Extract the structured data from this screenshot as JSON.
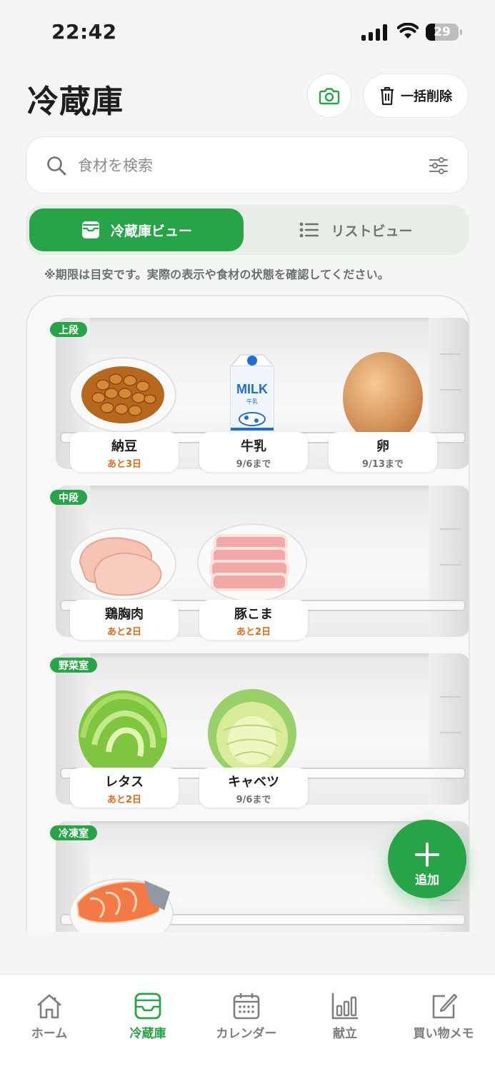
{
  "status_bar": {
    "time": "22:42",
    "battery": "29"
  },
  "header": {
    "title": "冷蔵庫",
    "camera_icon": "camera-icon",
    "bulk_delete_label": "一括削除"
  },
  "search": {
    "placeholder": "食材を検索"
  },
  "view_toggle": {
    "fridge_view_label": "冷蔵庫ビュー",
    "list_view_label": "リストビュー",
    "active": "fridge"
  },
  "note": "※期限は目安です。実際の表示や食材の状態を確認してください。",
  "colors": {
    "accent": "#27a348",
    "warning": "#e06a1c",
    "muted": "#6d726e"
  },
  "shelves": [
    {
      "label": "上段",
      "items": [
        {
          "name": "納豆",
          "expiry": "あと3日",
          "status": "warning",
          "icon": "natto-icon"
        },
        {
          "name": "牛乳",
          "expiry": "9/6まで",
          "status": "normal",
          "icon": "milk-carton-icon"
        },
        {
          "name": "卵",
          "expiry": "9/13まで",
          "status": "normal",
          "icon": "egg-icon"
        }
      ]
    },
    {
      "label": "中段",
      "items": [
        {
          "name": "鶏胸肉",
          "expiry": "あと2日",
          "status": "warning",
          "icon": "chicken-breast-icon"
        },
        {
          "name": "豚こま",
          "expiry": "あと2日",
          "status": "warning",
          "icon": "pork-slices-icon"
        }
      ]
    },
    {
      "label": "野菜室",
      "items": [
        {
          "name": "レタス",
          "expiry": "あと2日",
          "status": "warning",
          "icon": "lettuce-icon"
        },
        {
          "name": "キャベツ",
          "expiry": "9/6まで",
          "status": "normal",
          "icon": "cabbage-icon"
        }
      ]
    },
    {
      "label": "冷凍室",
      "items": [
        {
          "icon": "salmon-icon"
        }
      ]
    }
  ],
  "milk_carton_text": {
    "brand": "MILK",
    "sub": "牛乳"
  },
  "fab": {
    "label": "追加"
  },
  "tabs": [
    {
      "label": "ホーム",
      "icon": "home-icon"
    },
    {
      "label": "冷蔵庫",
      "icon": "fridge-icon",
      "active": true
    },
    {
      "label": "カレンダー",
      "icon": "calendar-icon"
    },
    {
      "label": "献立",
      "icon": "bar-chart-icon"
    },
    {
      "label": "買い物メモ",
      "icon": "memo-edit-icon"
    }
  ]
}
